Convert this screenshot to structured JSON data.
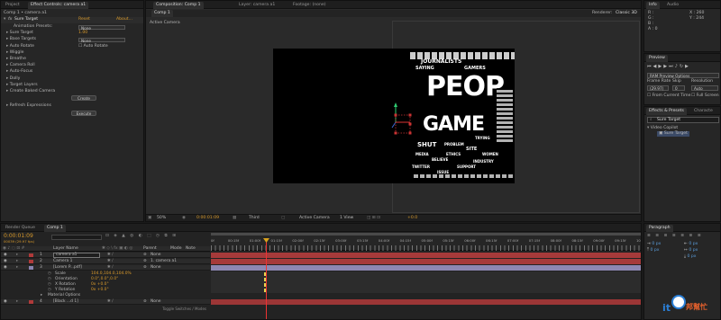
{
  "left_panel": {
    "tabs": [
      "Project",
      "Effect Controls: camera a1"
    ],
    "active_tab": 1,
    "breadcrumb": "Comp 1 • camera a1",
    "effect_name": "Sure Target",
    "reset_label": "Reset",
    "about_label": "About...",
    "rows": [
      {
        "label": "Animation Presets:",
        "value": "None",
        "indent": 2
      },
      {
        "label": "Sure Target",
        "value": "1.00",
        "indent": 1
      },
      {
        "label": "Base Targets",
        "value": "None",
        "indent": 1
      },
      {
        "label": "Auto Rotate",
        "value": "Auto Rotate",
        "indent": 1
      },
      {
        "label": "Wiggle",
        "value": "",
        "indent": 1
      },
      {
        "label": "Breathe",
        "value": "",
        "indent": 1
      },
      {
        "label": "Camera Roll",
        "value": "",
        "indent": 1
      },
      {
        "label": "Auto-Focus",
        "value": "",
        "indent": 1
      },
      {
        "label": "Dolly",
        "value": "",
        "indent": 1
      },
      {
        "label": "Target Layers",
        "value": "",
        "indent": 1
      },
      {
        "label": "Create Baked Camera",
        "value": "",
        "indent": 1
      }
    ],
    "create_btn": "Create",
    "refresh_label": "Refresh Expressions",
    "execute_btn": "Execute"
  },
  "comp_panel": {
    "tabs": [
      "Composition: Comp 1",
      "Layer: camera a1",
      "Footage: (none)"
    ],
    "subtab": "Comp 1",
    "renderer_label": "Renderer:",
    "renderer_value": "Classic 3D",
    "view_label": "Active Camera",
    "bottom": {
      "zoom": "50%",
      "timecode": "0:00:01:09",
      "resolution": "Third",
      "camera": "Active Camera",
      "views": "1 View",
      "exposure": "+0.0"
    }
  },
  "word_cloud": [
    {
      "w": "PEOP",
      "size": 30
    },
    {
      "w": "GAME",
      "size": 22
    },
    {
      "w": "JOURNALISTS",
      "size": 6
    },
    {
      "w": "SAYING",
      "size": 5
    },
    {
      "w": "SHUT",
      "size": 7
    },
    {
      "w": "PROBLEM",
      "size": 4
    },
    {
      "w": "SITE",
      "size": 5
    },
    {
      "w": "BELIEVE",
      "size": 4
    },
    {
      "w": "SUPPORT",
      "size": 4
    },
    {
      "w": "TRYING",
      "size": 4
    },
    {
      "w": "MEDIA",
      "size": 4
    },
    {
      "w": "WOMEN",
      "size": 4
    },
    {
      "w": "ETHICS",
      "size": 4
    },
    {
      "w": "TWITTER",
      "size": 4
    },
    {
      "w": "INDUSTRY",
      "size": 4
    },
    {
      "w": "ISSUE",
      "size": 4
    },
    {
      "w": "GAMERS",
      "size": 5
    }
  ],
  "right_panel": {
    "info_tabs": [
      "Info",
      "Audio"
    ],
    "info_lines": [
      "R :",
      "G :",
      "B :",
      "A : 0"
    ],
    "info_coords": [
      "X : 260",
      "Y : 244"
    ],
    "preview_tab": "Preview",
    "ram_label": "RAM Preview Options",
    "frame_rate_label": "Frame Rate",
    "skip_label": "Skip",
    "resolution_label": "Resolution",
    "frame_rate": "(29.97)",
    "skip": "0",
    "resolution": "Auto",
    "from_current": "From Current Time",
    "full_screen": "Full Screen",
    "effects_tabs": [
      "Effects & Presets",
      "Characte"
    ],
    "search_value": "Sure Target",
    "category": "Video Copilot",
    "effect_item": "Sure Target",
    "paragraph_tab": "Paragraph",
    "para_values": [
      "0 px",
      "0 px",
      "0 px",
      "0 px",
      "0 px"
    ]
  },
  "timeline": {
    "tabs": [
      "Render Queue",
      "Comp 1"
    ],
    "timecode": "0:00:01:09",
    "frames": "00039 (29.97 fps)",
    "col_layer": "Layer Name",
    "col_parent": "Parent",
    "col_mode": "Mode",
    "col_note": "Note",
    "ruler": [
      "0f",
      "00:15f",
      "01:00f",
      "01:15f",
      "02:00f",
      "02:15f",
      "03:00f",
      "03:15f",
      "04:00f",
      "04:15f",
      "05:00f",
      "05:15f",
      "06:00f",
      "06:15f",
      "07:00f",
      "07:15f",
      "08:00f",
      "08:15f",
      "09:00f",
      "09:15f",
      "10:0"
    ],
    "layers": [
      {
        "num": "1",
        "name": "camera a1",
        "parent": "None",
        "color": "#b03a3a",
        "bar": "#a63a3a"
      },
      {
        "num": "2",
        "name": "Camera 1",
        "parent": "1. camera a1",
        "color": "#b03a3a",
        "bar": "#a63a3a"
      },
      {
        "num": "3",
        "name": "[Lorem P...pdf]",
        "parent": "None",
        "color": "#8a84b0",
        "bar": "#8d87b2"
      }
    ],
    "props": [
      {
        "label": "Scale",
        "value": "104.0,104.0,104.0%"
      },
      {
        "label": "Orientation",
        "value": "0.0°,0.0°,0.0°"
      },
      {
        "label": "X Rotation",
        "value": "0x +0.0°"
      },
      {
        "label": "Y Rotation",
        "value": "0x +0.0°"
      }
    ],
    "material": "Material Options",
    "layer4": {
      "num": "4",
      "name": "[Black ...d 1]",
      "parent": "None",
      "color": "#b03a3a"
    },
    "footer": "Toggle Switches / Modes"
  }
}
